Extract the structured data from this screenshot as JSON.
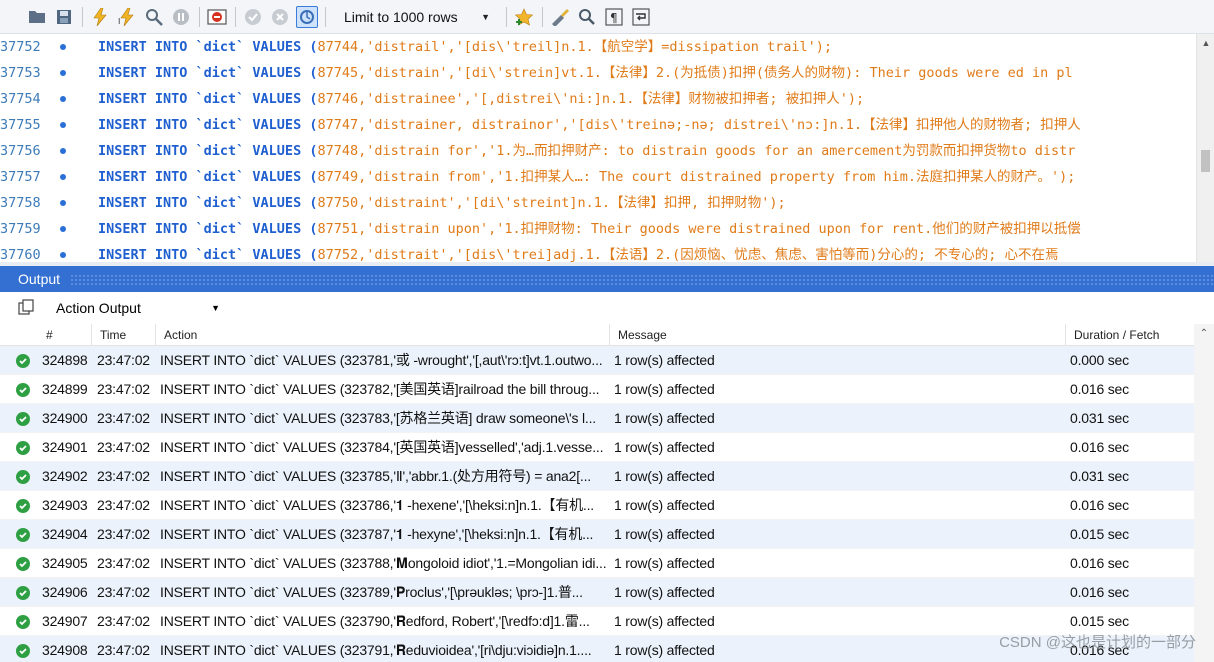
{
  "toolbar": {
    "icons": [
      "open-folder-icon",
      "save-icon",
      "execute-icon",
      "execute-all-icon",
      "explain-icon",
      "stop-icon",
      "toggle-results-icon",
      "commit-icon",
      "rollback-icon",
      "autocommit-icon",
      "add-snippet-icon",
      "beautify-icon",
      "find-icon",
      "invisible-chars-icon",
      "wrap-icon"
    ],
    "limit_label": "Limit to 1000 rows"
  },
  "editor": {
    "lines": [
      {
        "num": "37752",
        "pre": "INSERT INTO `dict` VALUES (",
        "val": "87744,'distrail','[dis\\'treil]n.1.【航空学】=dissipation trail');"
      },
      {
        "num": "37753",
        "pre": "INSERT INTO `dict` VALUES (",
        "val": "87745,'distrain','[di\\'strein]vt.1.【法律】2.(为抵债)扣押(债务人的财物): Their goods were ed in pl"
      },
      {
        "num": "37754",
        "pre": "INSERT INTO `dict` VALUES (",
        "val": "87746,'distrainee','[,distrei\\'ni:]n.1.【法律】财物被扣押者; 被扣押人');"
      },
      {
        "num": "37755",
        "pre": "INSERT INTO `dict` VALUES (",
        "val": "87747,'distrainer, distrainor','[dis\\'treinə;-nə; distrei\\'nɔ:]n.1.【法律】扣押他人的财物者; 扣押人"
      },
      {
        "num": "37756",
        "pre": "INSERT INTO `dict` VALUES (",
        "val": "87748,'distrain for','1.为…而扣押财产: to distrain goods for an amercement为罚款而扣押货物to distr"
      },
      {
        "num": "37757",
        "pre": "INSERT INTO `dict` VALUES (",
        "val": "87749,'distrain from','1.扣押某人…: The court distrained property from him.法庭扣押某人的财产。');"
      },
      {
        "num": "37758",
        "pre": "INSERT INTO `dict` VALUES (",
        "val": "87750,'distraint','[di\\'streint]n.1.【法律】扣押, 扣押财物');"
      },
      {
        "num": "37759",
        "pre": "INSERT INTO `dict` VALUES (",
        "val": "87751,'distrain upon','1.扣押财物: Their goods were distrained upon for rent.他们的财产被扣押以抵偿"
      },
      {
        "num": "37760",
        "pre": "INSERT INTO `dict` VALUES (",
        "val": "87752,'distrait','[dis\\'trei]adj.1.【法语】2.(因烦恼、忧虑、焦虑、害怕等而)分心的; 不专心的; 心不在焉"
      }
    ]
  },
  "output": {
    "title": "Output",
    "mode": "Action Output",
    "columns": [
      "#",
      "Time",
      "Action",
      "Message",
      "Duration / Fetch"
    ],
    "rows": [
      {
        "num": "324898",
        "time": "23:47:02",
        "action": "INSERT INTO `dict` VALUES (323781,'或 -wrought','[,aut\\'rɔ:t]vt.1.outwo...",
        "message": "1 row(s) affected",
        "duration": "0.000 sec"
      },
      {
        "num": "324899",
        "time": "23:47:02",
        "action": "INSERT INTO `dict` VALUES (323782,'[美国英语]railroad the bill throug...",
        "message": "1 row(s) affected",
        "duration": "0.016 sec"
      },
      {
        "num": "324900",
        "time": "23:47:02",
        "action": "INSERT INTO `dict` VALUES (323783,'[苏格兰英语] draw someone\\'s l...",
        "message": "1 row(s) affected",
        "duration": "0.031 sec"
      },
      {
        "num": "324901",
        "time": "23:47:02",
        "action": "INSERT INTO `dict` VALUES (323784,'[英国英语]vesselled','adj.1.vesse...",
        "message": "1 row(s) affected",
        "duration": "0.016 sec"
      },
      {
        "num": "324902",
        "time": "23:47:02",
        "action": "INSERT INTO `dict` VALUES (323785,'Ⅱ','abbr.1.(处方用符号) = ana2[...",
        "message": "1 row(s) affected",
        "duration": "0.031 sec"
      },
      {
        "num": "324903",
        "time": "23:47:02",
        "action": "INSERT INTO `dict` VALUES (323786,'𝟏 -hexene','[\\heksi:n]n.1.【有机...",
        "message": "1 row(s) affected",
        "duration": "0.016 sec"
      },
      {
        "num": "324904",
        "time": "23:47:02",
        "action": "INSERT INTO `dict` VALUES (323787,'𝟏 -hexyne','[\\heksi:n]n.1.【有机...",
        "message": "1 row(s) affected",
        "duration": "0.015 sec"
      },
      {
        "num": "324905",
        "time": "23:47:02",
        "action": "INSERT INTO `dict` VALUES (323788,'𝐌ongoloid idiot','1.=Mongolian idi...",
        "message": "1 row(s) affected",
        "duration": "0.016 sec"
      },
      {
        "num": "324906",
        "time": "23:47:02",
        "action": "INSERT INTO `dict` VALUES (323789,'𝐏roclus','[\\prəukləs; \\prɔ-]1.普...",
        "message": "1 row(s) affected",
        "duration": "0.016 sec"
      },
      {
        "num": "324907",
        "time": "23:47:02",
        "action": "INSERT INTO `dict` VALUES (323790,'𝐑edford, Robert','[\\redfɔ:d]1.雷...",
        "message": "1 row(s) affected",
        "duration": "0.015 sec"
      },
      {
        "num": "324908",
        "time": "23:47:02",
        "action": "INSERT INTO `dict` VALUES (323791,'𝐑eduvioidea','[ri\\dju:viɔidiə]n.1....",
        "message": "1 row(s) affected",
        "duration": "0.016 sec"
      }
    ]
  },
  "watermark": "CSDN @这也是计划的一部分"
}
